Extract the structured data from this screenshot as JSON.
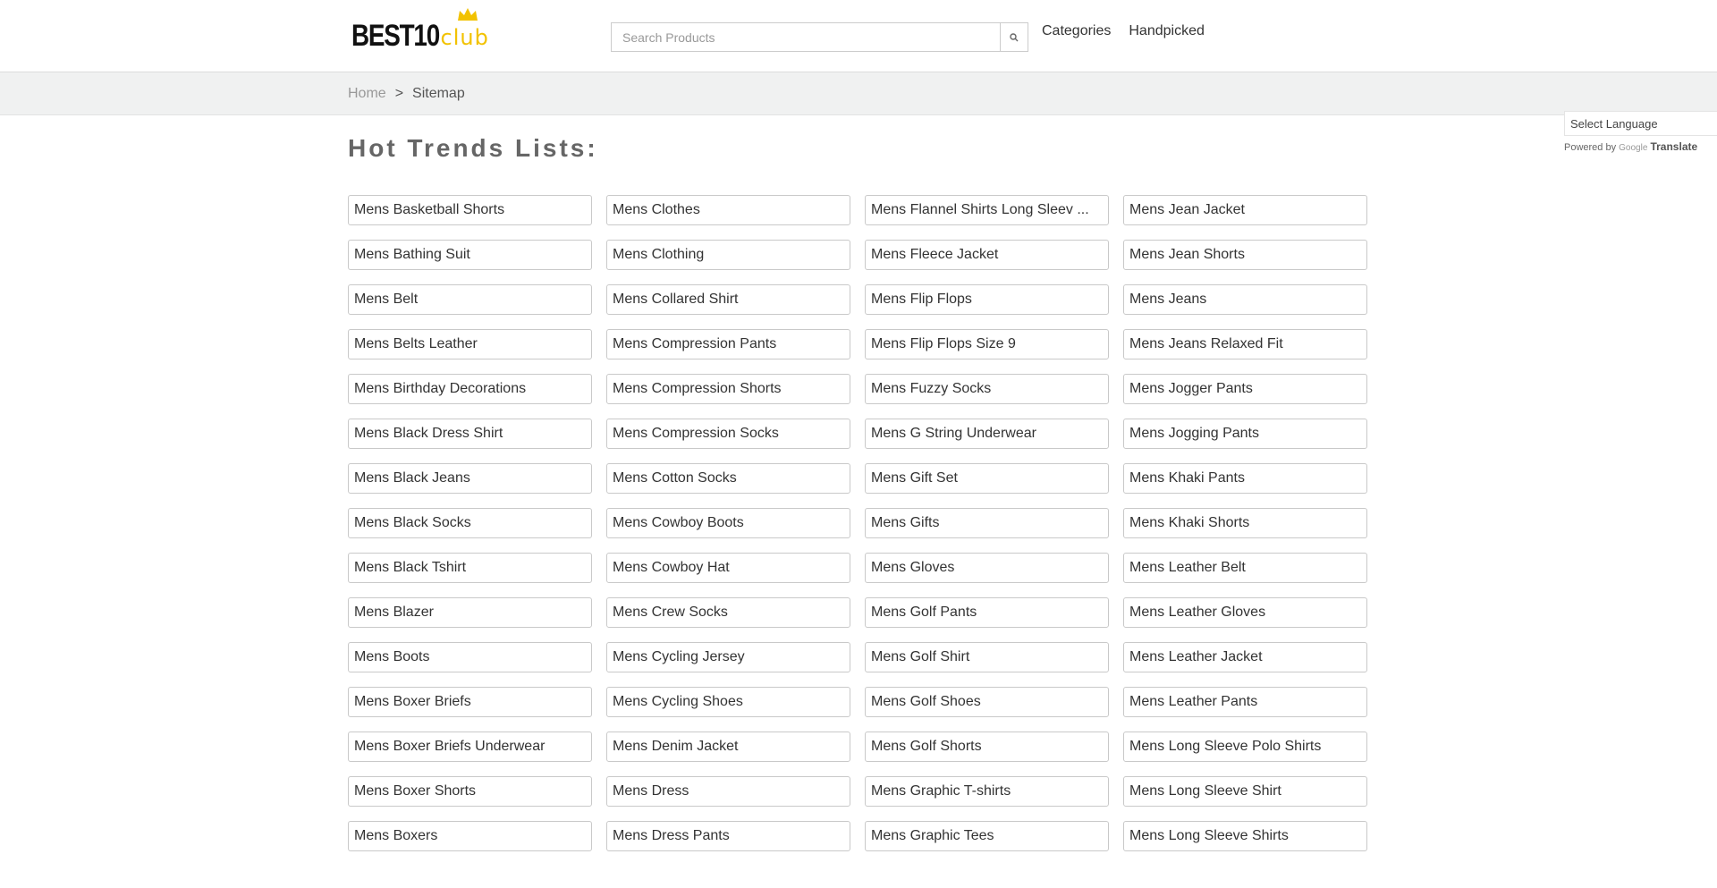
{
  "header": {
    "logo": {
      "main": "BEST10",
      "accent": "club",
      "accent_color": "#f2c200"
    },
    "search": {
      "placeholder": "Search Products",
      "value": "",
      "button_icon": "search-icon"
    },
    "nav": [
      {
        "label": "Categories"
      },
      {
        "label": "Handpicked"
      }
    ]
  },
  "breadcrumb": {
    "home": "Home",
    "separator": ">",
    "current": "Sitemap"
  },
  "translate": {
    "select_label": "Select Language",
    "powered_by": "Powered by",
    "google": "Google",
    "translate": "Translate"
  },
  "main": {
    "title": "Hot Trends Lists:",
    "columns": [
      [
        "Mens Basketball Shorts",
        "Mens Bathing Suit",
        "Mens Belt",
        "Mens Belts Leather",
        "Mens Birthday Decorations",
        "Mens Black Dress Shirt",
        "Mens Black Jeans",
        "Mens Black Socks",
        "Mens Black Tshirt",
        "Mens Blazer",
        "Mens Boots",
        "Mens Boxer Briefs",
        "Mens Boxer Briefs Underwear",
        "Mens Boxer Shorts",
        "Mens Boxers"
      ],
      [
        "Mens Clothes",
        "Mens Clothing",
        "Mens Collared Shirt",
        "Mens Compression Pants",
        "Mens Compression Shorts",
        "Mens Compression Socks",
        "Mens Cotton Socks",
        "Mens Cowboy Boots",
        "Mens Cowboy Hat",
        "Mens Crew Socks",
        "Mens Cycling Jersey",
        "Mens Cycling Shoes",
        "Mens Denim Jacket",
        "Mens Dress",
        "Mens Dress Pants"
      ],
      [
        "Mens Flannel Shirts Long Sleev ...",
        "Mens Fleece Jacket",
        "Mens Flip Flops",
        "Mens Flip Flops Size 9",
        "Mens Fuzzy Socks",
        "Mens G String Underwear",
        "Mens Gift Set",
        "Mens Gifts",
        "Mens Gloves",
        "Mens Golf Pants",
        "Mens Golf Shirt",
        "Mens Golf Shoes",
        "Mens Golf Shorts",
        "Mens Graphic T-shirts",
        "Mens Graphic Tees"
      ],
      [
        "Mens Jean Jacket",
        "Mens Jean Shorts",
        "Mens Jeans",
        "Mens Jeans Relaxed Fit",
        "Mens Jogger Pants",
        "Mens Jogging Pants",
        "Mens Khaki Pants",
        "Mens Khaki Shorts",
        "Mens Leather Belt",
        "Mens Leather Gloves",
        "Mens Leather Jacket",
        "Mens Leather Pants",
        "Mens Long Sleeve Polo Shirts",
        "Mens Long Sleeve Shirt",
        "Mens Long Sleeve Shirts"
      ]
    ]
  }
}
